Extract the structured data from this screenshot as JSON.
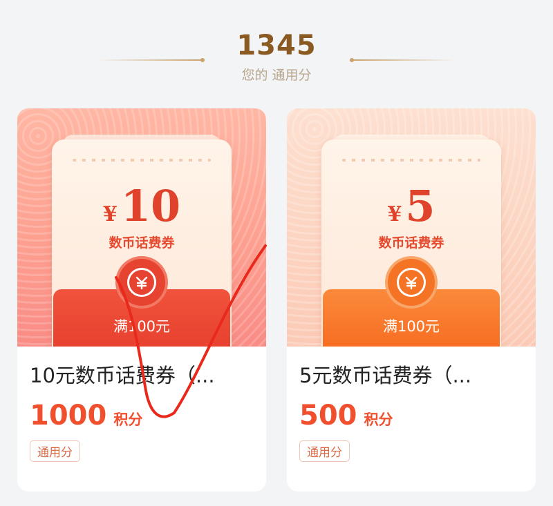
{
  "header": {
    "points": "1345",
    "caption": "您的 通用分"
  },
  "colors": {
    "accent": "#f0502e",
    "points_gold": "#8a5a22",
    "envelope_red": "#e8412f",
    "envelope_orange": "#f76d22"
  },
  "cards": [
    {
      "coupon_currency": "¥",
      "coupon_amount": "10",
      "coupon_title": "数币话费券",
      "condition": "满100元",
      "badge_icon": "digital-yuan-icon",
      "product_title": "10元数币话费券（...",
      "price": "1000",
      "price_unit": "积分",
      "tag": "通用分"
    },
    {
      "coupon_currency": "¥",
      "coupon_amount": "5",
      "coupon_title": "数币话费券",
      "condition": "满100元",
      "badge_icon": "digital-yuan-icon",
      "product_title": "5元数币话费券（...",
      "price": "500",
      "price_unit": "积分",
      "tag": "通用分"
    }
  ]
}
